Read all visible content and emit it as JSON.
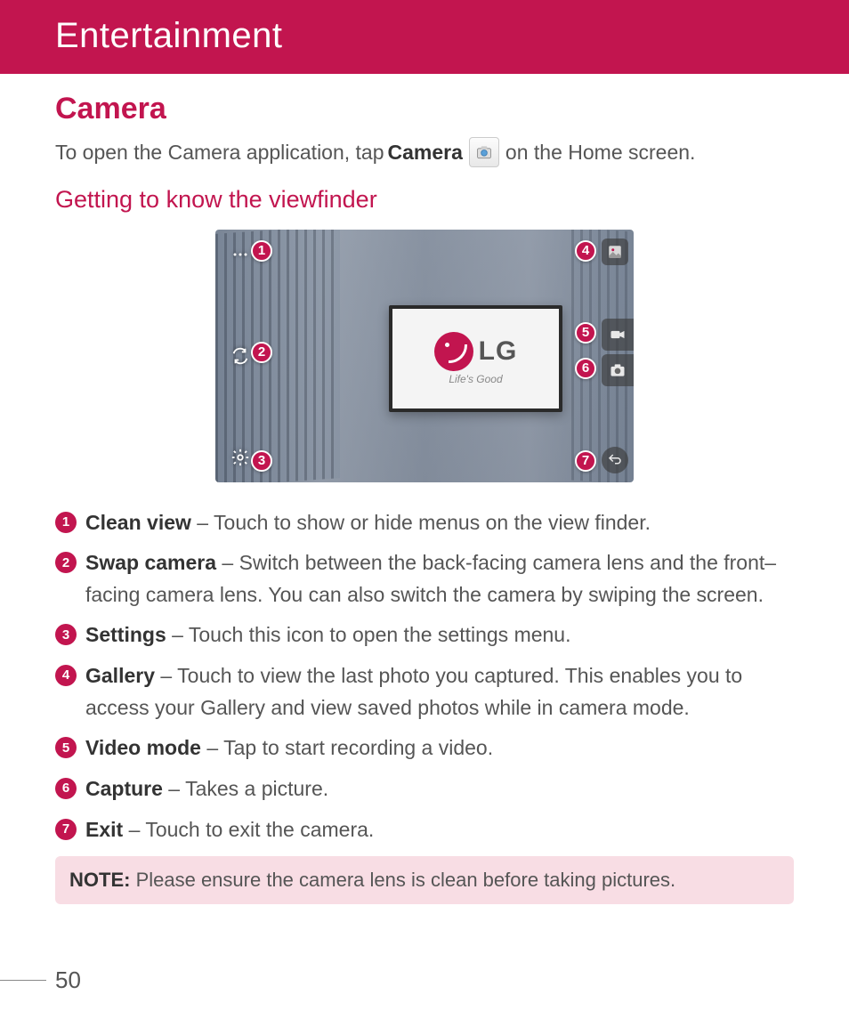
{
  "header": {
    "title": "Entertainment"
  },
  "section": {
    "title": "Camera"
  },
  "intro": {
    "pre": "To open the Camera application, tap ",
    "bold": "Camera",
    "post": " on the Home screen."
  },
  "subsection": {
    "title": "Getting to know the viewfinder"
  },
  "billboard": {
    "brand": "LG",
    "tagline": "Life's Good"
  },
  "callouts": {
    "c1": "1",
    "c2": "2",
    "c3": "3",
    "c4": "4",
    "c5": "5",
    "c6": "6",
    "c7": "7"
  },
  "items": [
    {
      "num": "1",
      "term": "Clean view",
      "desc": " – Touch to show or hide menus on the view finder."
    },
    {
      "num": "2",
      "term": "Swap camera",
      "desc": " – Switch between the back-facing camera lens and the front–facing camera lens. You can also switch the camera by swiping the screen."
    },
    {
      "num": "3",
      "term": "Settings",
      "desc": " – Touch this icon to open the settings menu."
    },
    {
      "num": "4",
      "term": "Gallery",
      "desc": " – Touch to view the last photo you captured. This enables you to access your Gallery and view saved photos while in camera mode."
    },
    {
      "num": "5",
      "term": "Video mode",
      "desc": " – Tap to start recording a video."
    },
    {
      "num": "6",
      "term": "Capture",
      "desc": " – Takes a picture."
    },
    {
      "num": "7",
      "term": "Exit",
      "desc": " – Touch to exit the camera."
    }
  ],
  "note": {
    "label": "NOTE:",
    "text": " Please ensure the camera lens is clean before taking pictures."
  },
  "page": "50"
}
